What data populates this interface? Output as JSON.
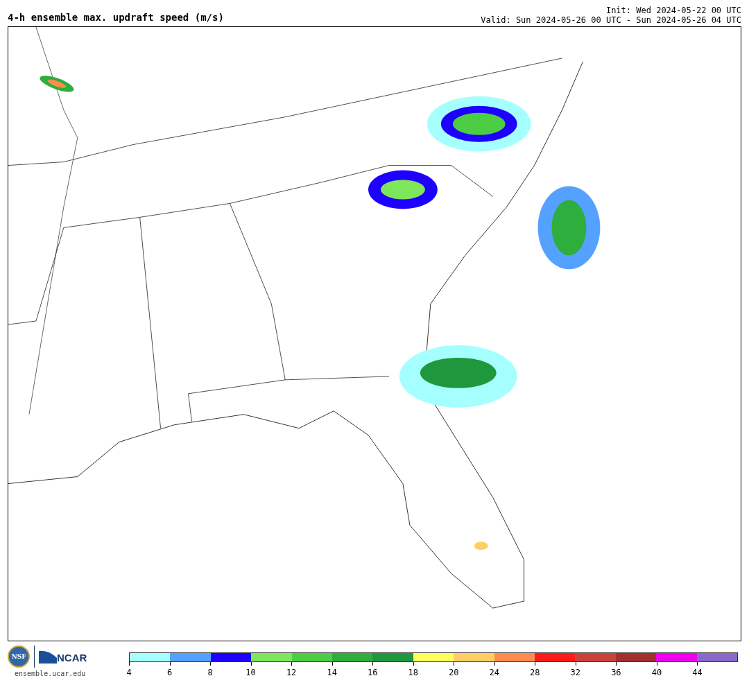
{
  "title": "4-h ensemble max. updraft speed (m/s)",
  "init": "Init: Wed 2024-05-22 00 UTC",
  "valid": "Valid: Sun 2024-05-26 00 UTC - Sun 2024-05-26 04 UTC",
  "logos": {
    "nsf": "NSF",
    "ncar": "NCAR",
    "site": "ensemble.ucar.edu"
  },
  "colorbar": {
    "segments": [
      {
        "color": "#a6ffff"
      },
      {
        "color": "#55a1ff"
      },
      {
        "color": "#1e00ff"
      },
      {
        "color": "#7ee65a"
      },
      {
        "color": "#4ccd44"
      },
      {
        "color": "#2eae3c"
      },
      {
        "color": "#1f973c"
      },
      {
        "color": "#fffd5a"
      },
      {
        "color": "#ffcf64"
      },
      {
        "color": "#ff8c4f"
      },
      {
        "color": "#ff1b1b"
      },
      {
        "color": "#cc403c"
      },
      {
        "color": "#a32f2f"
      },
      {
        "color": "#ee00ee"
      },
      {
        "color": "#8a68cc"
      }
    ],
    "ticks": [
      "4",
      "6",
      "8",
      "10",
      "12",
      "14",
      "16",
      "18",
      "20",
      "24",
      "28",
      "32",
      "36",
      "40",
      "44"
    ]
  }
}
